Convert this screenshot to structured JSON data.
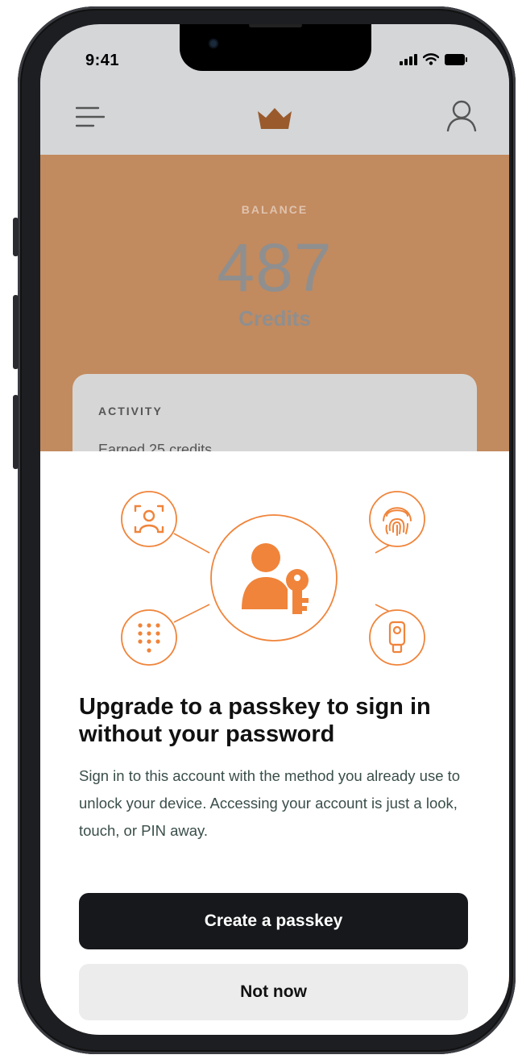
{
  "status": {
    "time": "9:41"
  },
  "app": {
    "balance_label": "BALANCE",
    "balance_value": "487",
    "balance_unit": "Credits",
    "activity_title": "ACTIVITY",
    "activity_row": "Earned 25 credits"
  },
  "sheet": {
    "title": "Upgrade to a passkey to sign in without your password",
    "description": "Sign in to this account with the method you already use to unlock your device. Accessing your account is just a look, touch, or PIN away.",
    "primary_label": "Create a passkey",
    "secondary_label": "Not now"
  },
  "colors": {
    "accent": "#f0843a",
    "brand_header": "#c28a5f",
    "button_primary": "#16181b"
  },
  "icons": [
    "menu-icon",
    "crown-icon",
    "profile-icon",
    "face-scan-icon",
    "fingerprint-icon",
    "keypad-icon",
    "security-key-icon",
    "user-key-icon"
  ]
}
